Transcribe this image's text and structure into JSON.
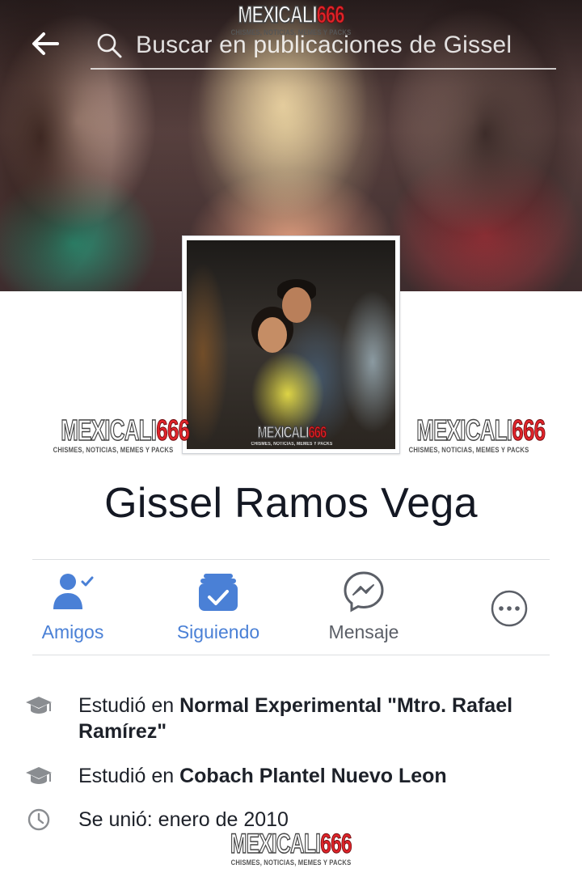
{
  "header": {
    "search_placeholder": "Buscar en publicaciones de Gissel"
  },
  "watermark": {
    "brand_a": "MEXICALI",
    "brand_b": "666",
    "tagline": "CHISMES, NOTICIAS, MEMES Y PACKS"
  },
  "profile": {
    "name": "Gissel Ramos Vega"
  },
  "actions": [
    {
      "label": "Amigos",
      "icon": "friends-check-icon",
      "color": "#4a80d6"
    },
    {
      "label": "Siguiendo",
      "icon": "following-icon",
      "color": "#4a80d6"
    },
    {
      "label": "Mensaje",
      "icon": "messenger-icon",
      "color": "#5b5f67"
    },
    {
      "label": "",
      "icon": "more-options-icon",
      "color": "#5b5f67"
    }
  ],
  "about": {
    "education_1": {
      "prefix": "Estudió en",
      "place": "Normal Experimental \"Mtro. Rafael Ramírez\"",
      "icon": "graduation-cap-icon"
    },
    "education_2": {
      "prefix": "Estudió en",
      "place": "Cobach Plantel Nuevo Leon",
      "icon": "graduation-cap-icon"
    },
    "joined": {
      "text": "Se unió: enero de 2010",
      "icon": "clock-icon"
    }
  },
  "colors": {
    "accent": "#4a80d6",
    "icon_gray": "#8a8d91",
    "divider": "#dddfe2"
  }
}
